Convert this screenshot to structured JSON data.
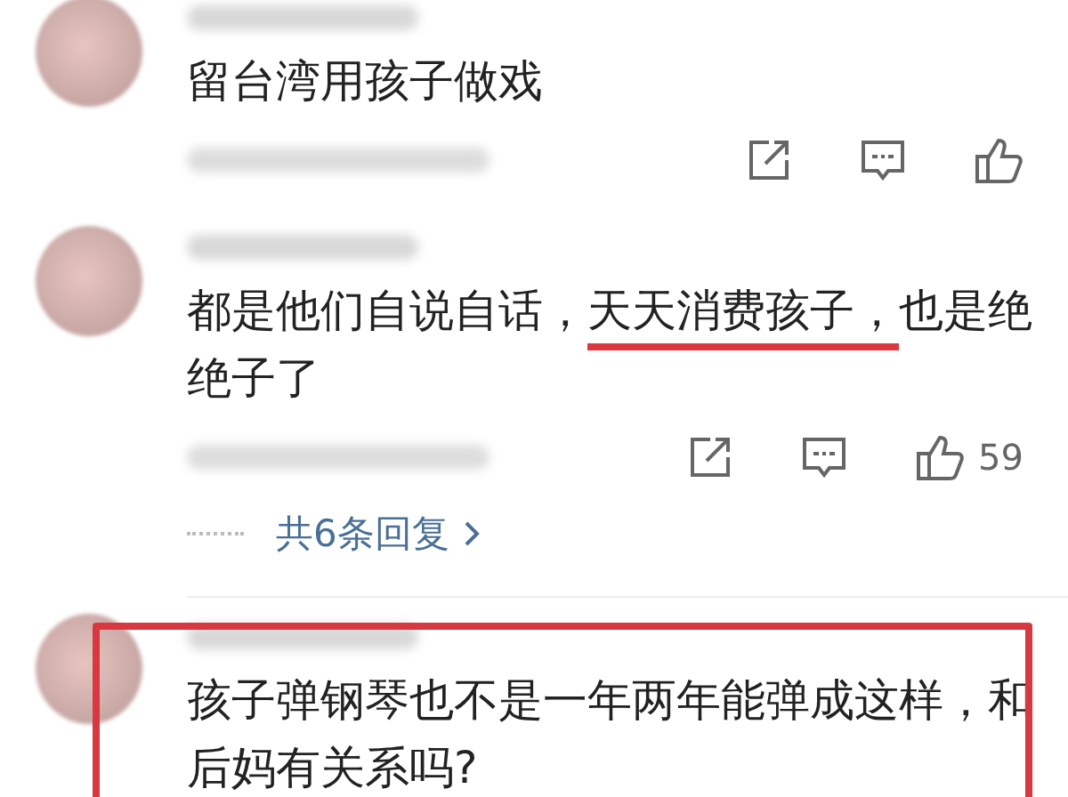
{
  "comments": [
    {
      "segments": [
        {
          "text": "留台湾用孩子做戏",
          "underlined": false
        }
      ],
      "boxed": false
    },
    {
      "segments": [
        {
          "text": "都是他们自说自话，",
          "underlined": false
        },
        {
          "text": "天天消费孩子，",
          "underlined": true
        },
        {
          "text": "也是绝绝子了",
          "underlined": false
        }
      ],
      "likes": "59",
      "replies_link": "共6条回复",
      "boxed": false
    },
    {
      "segments": [
        {
          "text": "孩子弹钢琴也不是一年两年能弹成这样，和后妈有关系吗?",
          "underlined": false
        }
      ],
      "boxed": true
    }
  ]
}
